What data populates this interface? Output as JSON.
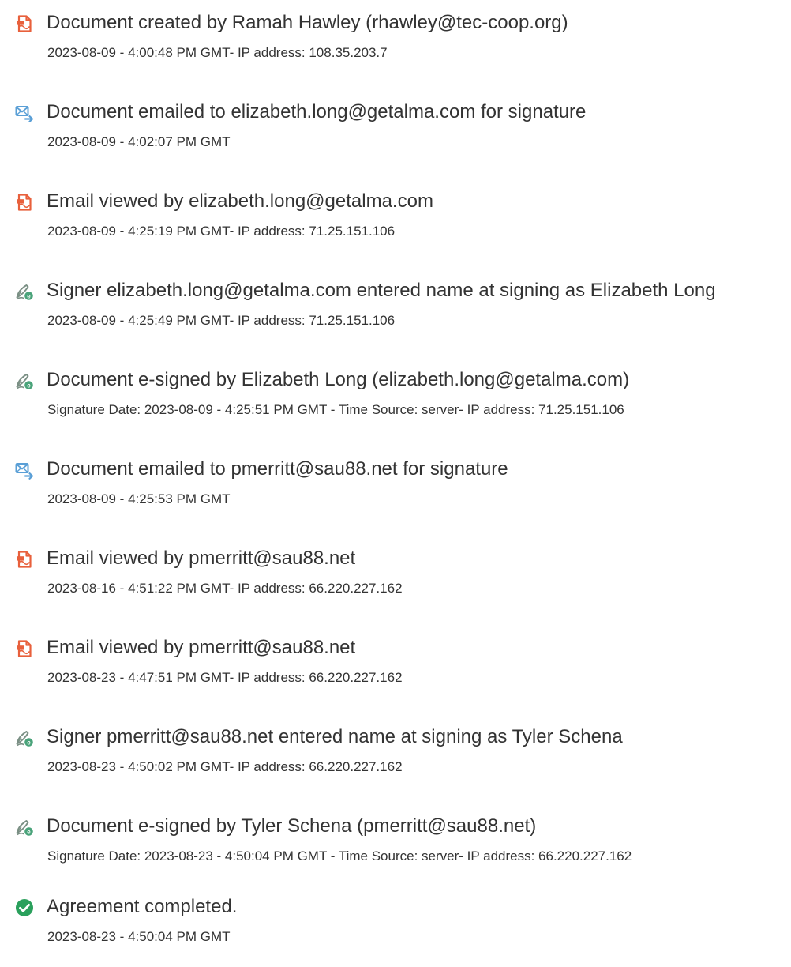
{
  "colors": {
    "document_icon": "#e8603c",
    "email_icon": "#5a9fd6",
    "signature_icon": "#4aa37a",
    "completed_icon": "#2aa05c",
    "text": "#333333"
  },
  "events": [
    {
      "icon": "document-icon",
      "title": "Document created by Ramah Hawley (rhawley@tec-coop.org)",
      "meta": "2023-08-09 - 4:00:48 PM GMT- IP address: 108.35.203.7"
    },
    {
      "icon": "email-icon",
      "title": "Document emailed to elizabeth.long@getalma.com for signature",
      "meta": "2023-08-09 - 4:02:07 PM GMT"
    },
    {
      "icon": "document-icon",
      "title": "Email viewed by elizabeth.long@getalma.com",
      "meta": "2023-08-09 - 4:25:19 PM GMT- IP address: 71.25.151.106"
    },
    {
      "icon": "signature-icon",
      "title": "Signer elizabeth.long@getalma.com entered name at signing as Elizabeth Long",
      "meta": "2023-08-09 - 4:25:49 PM GMT- IP address: 71.25.151.106"
    },
    {
      "icon": "signature-icon",
      "title": "Document e-signed by Elizabeth Long (elizabeth.long@getalma.com)",
      "meta": "Signature Date: 2023-08-09 - 4:25:51 PM GMT - Time Source: server- IP address: 71.25.151.106"
    },
    {
      "icon": "email-icon",
      "title": "Document emailed to pmerritt@sau88.net for signature",
      "meta": "2023-08-09 - 4:25:53 PM GMT"
    },
    {
      "icon": "document-icon",
      "title": "Email viewed by pmerritt@sau88.net",
      "meta": "2023-08-16 - 4:51:22 PM GMT- IP address: 66.220.227.162"
    },
    {
      "icon": "document-icon",
      "title": "Email viewed by pmerritt@sau88.net",
      "meta": "2023-08-23 - 4:47:51 PM GMT- IP address: 66.220.227.162"
    },
    {
      "icon": "signature-icon",
      "title": "Signer pmerritt@sau88.net entered name at signing as Tyler Schena",
      "meta": "2023-08-23 - 4:50:02 PM GMT- IP address: 66.220.227.162"
    },
    {
      "icon": "signature-icon",
      "title": "Document e-signed by Tyler Schena (pmerritt@sau88.net)",
      "meta": "Signature Date: 2023-08-23 - 4:50:04 PM GMT - Time Source: server- IP address: 66.220.227.162"
    },
    {
      "icon": "check-circle-icon",
      "title": "Agreement completed.",
      "meta": "2023-08-23 - 4:50:04 PM GMT"
    }
  ]
}
